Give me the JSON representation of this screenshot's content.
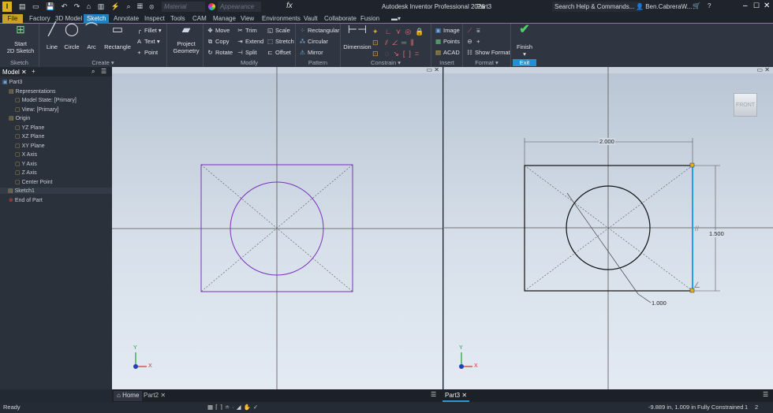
{
  "app": {
    "title": "Autodesk Inventor Professional 2026",
    "document": "Part3",
    "search_placeholder": "Search Help & Commands...",
    "user": "Ben.CabreraW...",
    "material": "Material",
    "appearance": "Appearance",
    "fx": "fx"
  },
  "tabs": [
    "File",
    "Factory",
    "3D Model",
    "Sketch",
    "Annotate",
    "Inspect",
    "Tools",
    "CAM",
    "Manage",
    "View",
    "Environments",
    "Vault",
    "Collaborate",
    "Fusion"
  ],
  "ribbon": {
    "sketch": {
      "start": "Start",
      "start2": "2D Sketch",
      "label": "Sketch"
    },
    "create": {
      "line": "Line",
      "circle": "Circle",
      "arc": "Arc",
      "rectangle": "Rectangle",
      "fillet": "Fillet",
      "text": "Text",
      "point": "Point",
      "label": "Create"
    },
    "project": {
      "l1": "Project",
      "l2": "Geometry"
    },
    "modify": {
      "move": "Move",
      "copy": "Copy",
      "rotate": "Rotate",
      "trim": "Trim",
      "extend": "Extend",
      "split": "Split",
      "scale": "Scale",
      "stretch": "Stretch",
      "offset": "Offset",
      "label": "Modify"
    },
    "pattern": {
      "rect": "Rectangular",
      "circ": "Circular",
      "mirror": "Mirror",
      "label": "Pattern"
    },
    "constrain": {
      "dimension": "Dimension",
      "label": "Constrain"
    },
    "insert": {
      "image": "Image",
      "points": "Points",
      "acad": "ACAD",
      "label": "Insert"
    },
    "format": {
      "show": "Show Format",
      "label": "Format"
    },
    "exit": {
      "finish": "Finish",
      "label": "Exit"
    }
  },
  "browser": {
    "tab": "Model",
    "items": [
      {
        "label": "Part3",
        "level": 0
      },
      {
        "label": "Representations",
        "level": 1
      },
      {
        "label": "Model State: [Primary]",
        "level": 2
      },
      {
        "label": "View: [Primary]",
        "level": 2
      },
      {
        "label": "Origin",
        "level": 1
      },
      {
        "label": "YZ Plane",
        "level": 2
      },
      {
        "label": "XZ Plane",
        "level": 2
      },
      {
        "label": "XY Plane",
        "level": 2
      },
      {
        "label": "X Axis",
        "level": 2
      },
      {
        "label": "Y Axis",
        "level": 2
      },
      {
        "label": "Z Axis",
        "level": 2
      },
      {
        "label": "Center Point",
        "level": 2
      },
      {
        "label": "Sketch1",
        "level": 1
      },
      {
        "label": "End of Part",
        "level": 1
      }
    ]
  },
  "viewport": {
    "viewcube": "FRONT",
    "dim_width": "2.000",
    "dim_height": "1.500",
    "dim_diameter": "1.000",
    "axis_x": "X",
    "axis_y": "Y"
  },
  "doc_tabs": {
    "home": "Home",
    "part2": "Part2",
    "part3": "Part3"
  },
  "status": {
    "text": "Ready",
    "coords": "-9.889 in, 1.009 in",
    "constraint": "Fully Constrained",
    "n1": "1",
    "n2": "2"
  },
  "colors": {
    "accent": "#1f7fc0",
    "sketch_left": "#7b2fbf",
    "selected": "#1fa0e8"
  }
}
